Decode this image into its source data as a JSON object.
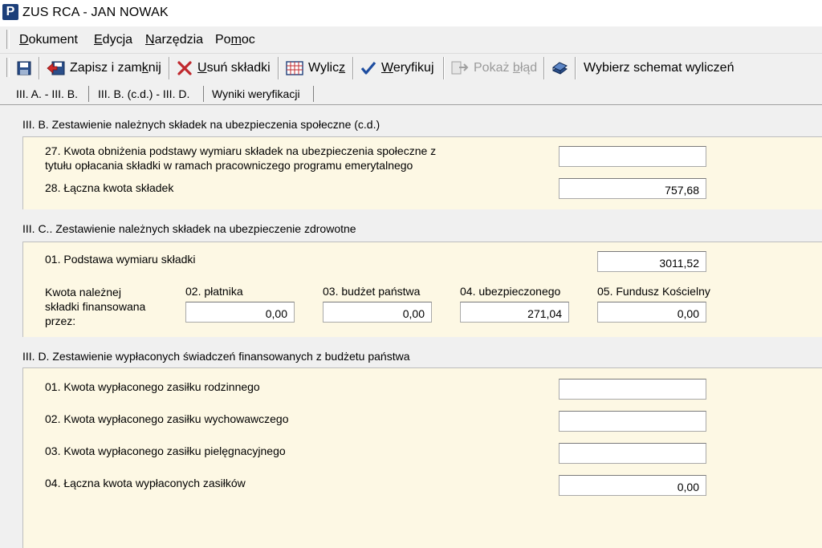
{
  "window": {
    "title": "ZUS RCA - JAN NOWAK",
    "logo_letter": "P"
  },
  "menu": {
    "items": [
      {
        "label_pre": "",
        "label_u": "D",
        "label_post": "okument"
      },
      {
        "label_pre": "",
        "label_u": "E",
        "label_post": "dycja"
      },
      {
        "label_pre": "",
        "label_u": "N",
        "label_post": "arzędzia"
      },
      {
        "label_pre": "Po",
        "label_u": "m",
        "label_post": "oc"
      }
    ]
  },
  "toolbar": {
    "save_close": {
      "pre": "Zapisz i zam",
      "u": "k",
      "post": "nij"
    },
    "delete": {
      "pre": "",
      "u": "U",
      "post": "suń składki"
    },
    "calculate": {
      "pre": "Wylic",
      "u": "z",
      "post": ""
    },
    "verify": {
      "pre": "",
      "u": "W",
      "post": "eryfikuj"
    },
    "show_error": {
      "pre": "Pokaż ",
      "u": "b",
      "post": "łąd"
    },
    "choose_scheme": "Wybierz schemat wyliczeń"
  },
  "tabs": [
    "III. A. - III. B.",
    "III. B. (c.d.) - III. D.",
    "Wyniki weryfikacji"
  ],
  "section_b": {
    "title": "III. B. Zestawienie należnych składek na ubezpieczenia społeczne (c.d.)",
    "field27_line1": "27. Kwota obniżenia podstawy wymiaru składek na ubezpieczenia społeczne z",
    "field27_line2": "tytułu opłacania składki w ramach pracowniczego programu emerytalnego",
    "field27_value": "",
    "field28_label": "28. Łączna kwota składek",
    "field28_value": "757,68"
  },
  "section_c": {
    "title": "III. C.. Zestawienie należnych składek na ubezpieczenie zdrowotne",
    "field01_label": "01. Podstawa wymiaru składki",
    "field01_value": "3011,52",
    "financed_line1": "Kwota należnej",
    "financed_line2": "składki finansowana",
    "financed_line3": "przez:",
    "col02_label": "02. płatnika",
    "col02_value": "0,00",
    "col03_label": "03. budżet państwa",
    "col03_value": "0,00",
    "col04_label": "04. ubezpieczonego",
    "col04_value": "271,04",
    "col05_label": "05. Fundusz Kościelny",
    "col05_value": "0,00"
  },
  "section_d": {
    "title": "III. D. Zestawienie wypłaconych świadczeń finansowanych z budżetu państwa",
    "f01_label": "01. Kwota wypłaconego zasiłku rodzinnego",
    "f01_value": "",
    "f02_label": "02. Kwota wypłaconego zasiłku wychowawczego",
    "f02_value": "",
    "f03_label": "03. Kwota wypłaconego zasiłku pielęgnacyjnego",
    "f03_value": "",
    "f04_label": "04. Łączna kwota wypłaconych zasiłków",
    "f04_value": "0,00"
  }
}
